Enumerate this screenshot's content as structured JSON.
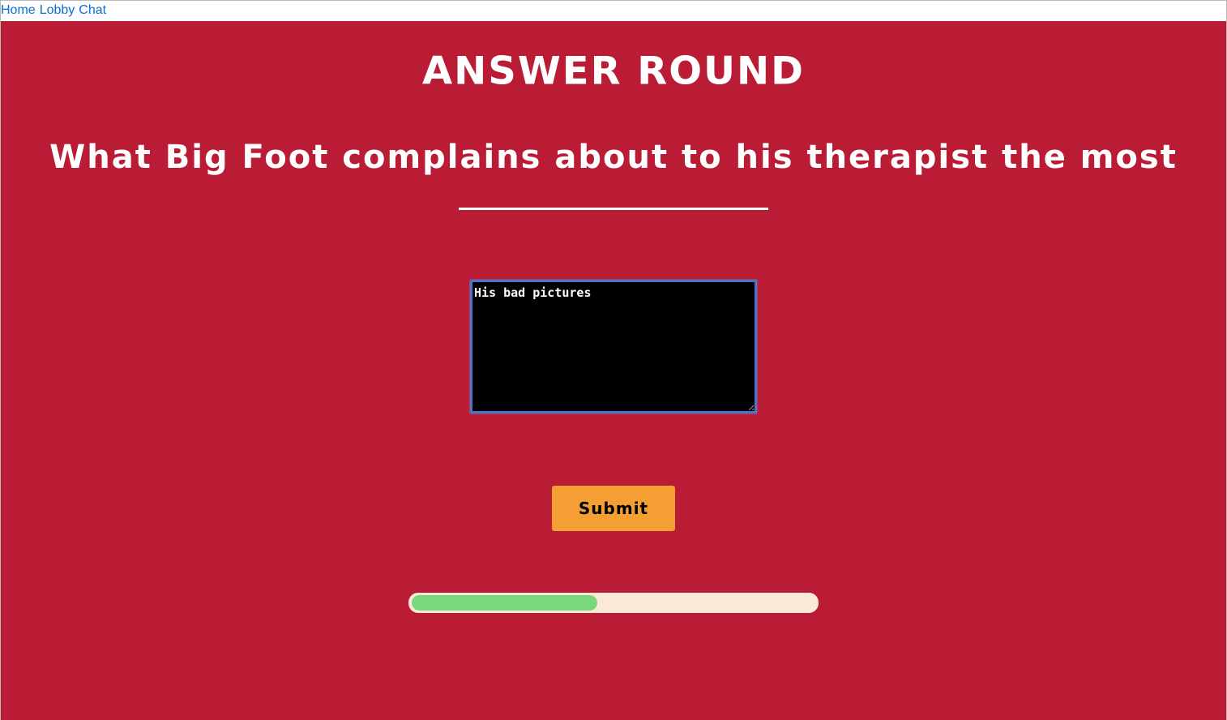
{
  "nav": {
    "links": [
      "Home",
      "Lobby",
      "Chat"
    ]
  },
  "game": {
    "round_title": "ANSWER ROUND",
    "prompt": "What Big Foot complains about to his therapist the most",
    "answer_value": "His bad pictures",
    "submit_label": "Submit",
    "timer_progress": 0.46
  },
  "colors": {
    "background": "#ba1c36",
    "submit_button": "#f49e34",
    "progress_fill": "#7ad77c",
    "progress_track": "#fbe9d8",
    "link": "#0a6ed1"
  }
}
